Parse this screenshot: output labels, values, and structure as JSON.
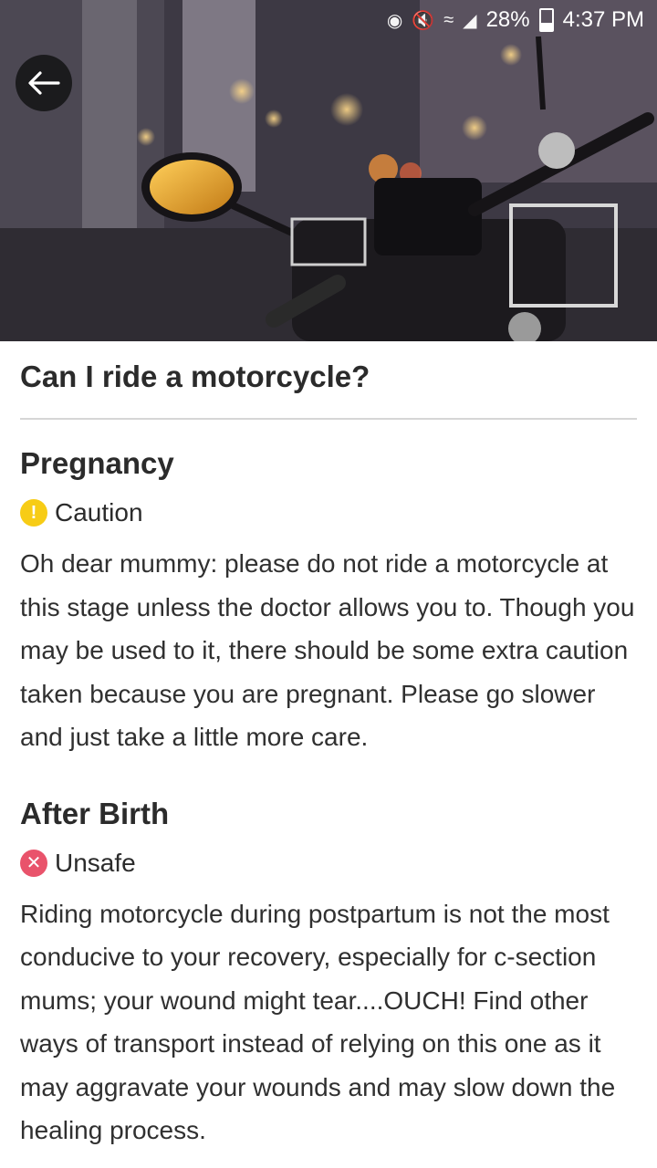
{
  "status_bar": {
    "battery_percent": "28%",
    "time": "4:37 PM",
    "icons": [
      "battery-saver-icon",
      "mute-icon",
      "wifi-icon",
      "signal-icon",
      "battery-icon"
    ]
  },
  "hero": {
    "image": "motorcycle-photo"
  },
  "question": {
    "title": "Can I ride a motorcycle?"
  },
  "sections": [
    {
      "heading": "Pregnancy",
      "status_label": "Caution",
      "status_icon": "exclamation-icon",
      "status_color": "#f7cc16",
      "body": "Oh dear mummy: please do not ride a motorcycle at this stage unless the doctor allows you to. Though you may be used to it, there should be some extra caution taken because you are pregnant. Please go slower and just take a little more care."
    },
    {
      "heading": "After Birth",
      "status_label": "Unsafe",
      "status_icon": "x-icon",
      "status_color": "#e9536b",
      "body": "Riding motorcycle during postpartum is not the most conducive to your recovery, especially for c-section mums; your wound might tear....OUCH! Find other ways of transport instead of relying on this one as it may aggravate your wounds and may slow down the healing process."
    }
  ]
}
